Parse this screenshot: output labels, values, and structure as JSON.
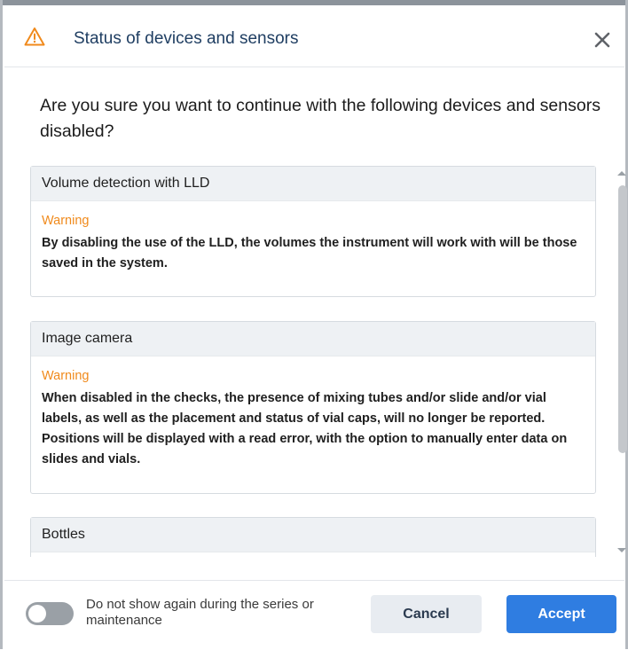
{
  "dialog": {
    "title": "Status of devices and sensors",
    "header_icon": "warning-triangle-icon",
    "close_icon": "close-icon",
    "question": "Are you sure you want to continue with the following devices and sensors disabled?"
  },
  "items": [
    {
      "name": "Volume detection with LLD",
      "warning_label": "Warning",
      "warning_text": "By disabling the use of the LLD, the volumes the instrument will work with will be those saved in the system."
    },
    {
      "name": "Image camera",
      "warning_label": "Warning",
      "warning_text": "When disabled in the checks, the presence of mixing tubes and/or slide and/or vial labels, as well as the placement and status of vial caps, will no longer be reported. Positions will be displayed with a read error, with the option to manually enter data on slides and vials."
    },
    {
      "name": "Bottles"
    }
  ],
  "footer": {
    "toggle_label": "Do not show again during the series or maintenance",
    "toggle_on": false,
    "cancel_label": "Cancel",
    "accept_label": "Accept"
  },
  "colors": {
    "title": "#1f3e62",
    "warning": "#f08a1c",
    "accept_button": "#2f7de1",
    "cancel_button": "#e8ecf1",
    "card_header": "#eef1f4"
  }
}
